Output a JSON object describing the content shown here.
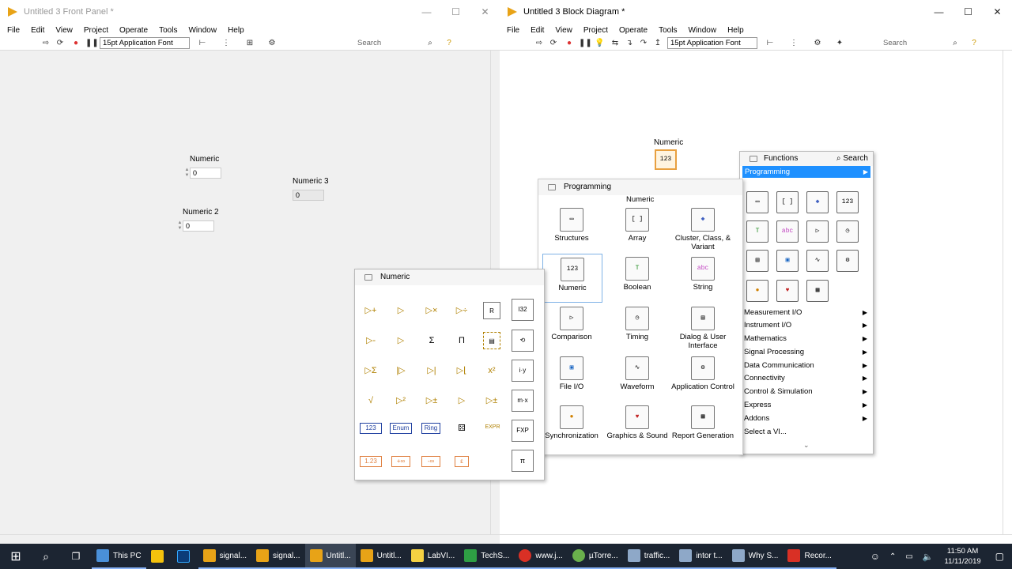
{
  "front_panel": {
    "title": "Untitled 3 Front Panel *",
    "menu": [
      "File",
      "Edit",
      "View",
      "Project",
      "Operate",
      "Tools",
      "Window",
      "Help"
    ],
    "font": "15pt Application Font",
    "search_placeholder": "Search",
    "controls": [
      {
        "label": "Numeric",
        "value": "0"
      },
      {
        "label": "Numeric 2",
        "value": "0"
      }
    ],
    "indicators": [
      {
        "label": "Numeric 3",
        "value": "0"
      }
    ]
  },
  "block_diagram": {
    "title": "Untitled 3 Block Diagram *",
    "menu": [
      "File",
      "Edit",
      "View",
      "Project",
      "Operate",
      "Tools",
      "Window",
      "Help"
    ],
    "font": "15pt Application Font",
    "search_placeholder": "Search",
    "terminal_label": "Numeric"
  },
  "programming_palette": {
    "title": "Programming",
    "hover_tip": "Numeric",
    "items": [
      {
        "label": "Structures",
        "icon": "structures-icon"
      },
      {
        "label": "Array",
        "icon": "array-icon"
      },
      {
        "label": "Cluster, Class, & Variant",
        "icon": "cluster-icon"
      },
      {
        "label": "Numeric",
        "icon": "numeric-icon"
      },
      {
        "label": "Boolean",
        "icon": "boolean-icon"
      },
      {
        "label": "String",
        "icon": "string-icon"
      },
      {
        "label": "Comparison",
        "icon": "comparison-icon"
      },
      {
        "label": "Timing",
        "icon": "timing-icon"
      },
      {
        "label": "Dialog & User Interface",
        "icon": "dialog-icon"
      },
      {
        "label": "File I/O",
        "icon": "file-io-icon"
      },
      {
        "label": "Waveform",
        "icon": "waveform-icon"
      },
      {
        "label": "Application Control",
        "icon": "app-control-icon"
      },
      {
        "label": "Synchronization",
        "icon": "sync-icon"
      },
      {
        "label": "Graphics & Sound",
        "icon": "graphics-icon"
      },
      {
        "label": "Report Generation",
        "icon": "report-icon"
      }
    ]
  },
  "numeric_palette": {
    "title": "Numeric"
  },
  "functions_palette": {
    "title": "Functions",
    "search_label": "Search",
    "selected": "Programming",
    "categories": [
      "Measurement I/O",
      "Instrument I/O",
      "Mathematics",
      "Signal Processing",
      "Data Communication",
      "Connectivity",
      "Control & Simulation",
      "Express",
      "Addons",
      "Select a VI..."
    ]
  },
  "taskbar": {
    "items": [
      {
        "label": "This PC",
        "color": "#4a90d9",
        "state": "open"
      },
      {
        "label": "",
        "color": "#f4c20d",
        "state": ""
      },
      {
        "label": "",
        "color": "#0b3c78",
        "state": ""
      },
      {
        "label": "signal...",
        "color": "#e8a317",
        "state": "open"
      },
      {
        "label": "signal...",
        "color": "#e8a317",
        "state": "open"
      },
      {
        "label": "Untitl...",
        "color": "#e8a317",
        "state": "active"
      },
      {
        "label": "Untitl...",
        "color": "#e8a317",
        "state": "open"
      },
      {
        "label": "LabVI...",
        "color": "#f5d142",
        "state": "open"
      },
      {
        "label": "TechS...",
        "color": "#2e9e44",
        "state": "open"
      },
      {
        "label": "www.j...",
        "color": "#d93025",
        "state": "open"
      },
      {
        "label": "µTorre...",
        "color": "#6ab04c",
        "state": "open"
      },
      {
        "label": "traffic...",
        "color": "#8ea8c8",
        "state": "open"
      },
      {
        "label": "intor t...",
        "color": "#8ea8c8",
        "state": "open"
      },
      {
        "label": "Why S...",
        "color": "#8ea8c8",
        "state": "open"
      },
      {
        "label": "Recor...",
        "color": "#d93025",
        "state": "open"
      }
    ],
    "time": "11:50 AM",
    "date": "11/11/2019"
  }
}
